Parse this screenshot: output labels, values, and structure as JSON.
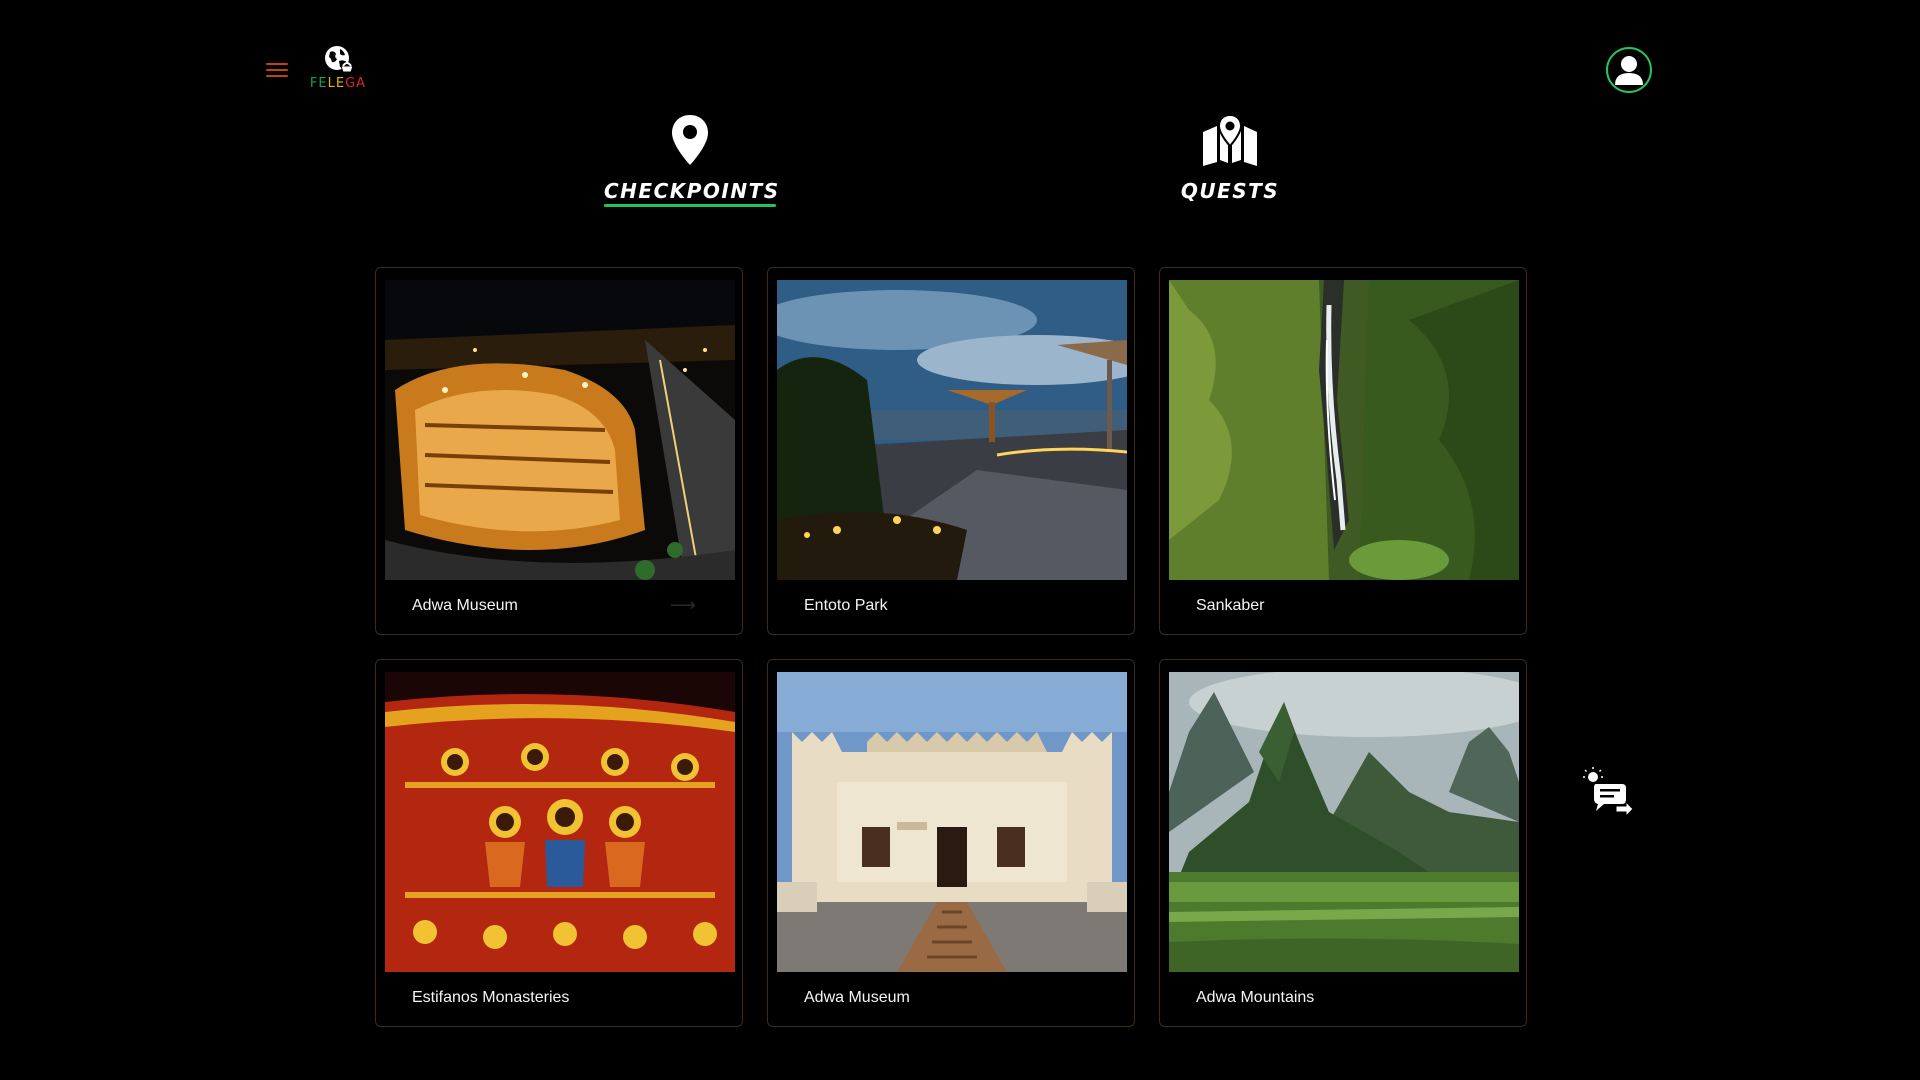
{
  "header": {
    "logo_text": "FELEGA",
    "menu_icon": "hamburger-menu-icon",
    "profile_icon": "user-icon"
  },
  "tabs": [
    {
      "label": "CHECKPOINTS",
      "icon": "map-pin-icon",
      "active": true
    },
    {
      "label": "QUESTS",
      "icon": "map-marker-icon",
      "active": false
    }
  ],
  "checkpoints": [
    {
      "name": "Adwa Museum",
      "photo": "city-night"
    },
    {
      "name": "Entoto Park",
      "photo": "park-dusk"
    },
    {
      "name": "Sankaber",
      "photo": "waterfall"
    },
    {
      "name": "Estifanos Monasteries",
      "photo": "church-mural"
    },
    {
      "name": "Adwa Museum",
      "photo": "museum-rooftop"
    },
    {
      "name": "Adwa Mountains",
      "photo": "mountains"
    }
  ],
  "colors": {
    "accent": "#22c55e",
    "menu": "#c2410c",
    "card_border": "#3b2a1e",
    "background": "#000000"
  },
  "floating": {
    "icon": "chat-support-icon"
  }
}
